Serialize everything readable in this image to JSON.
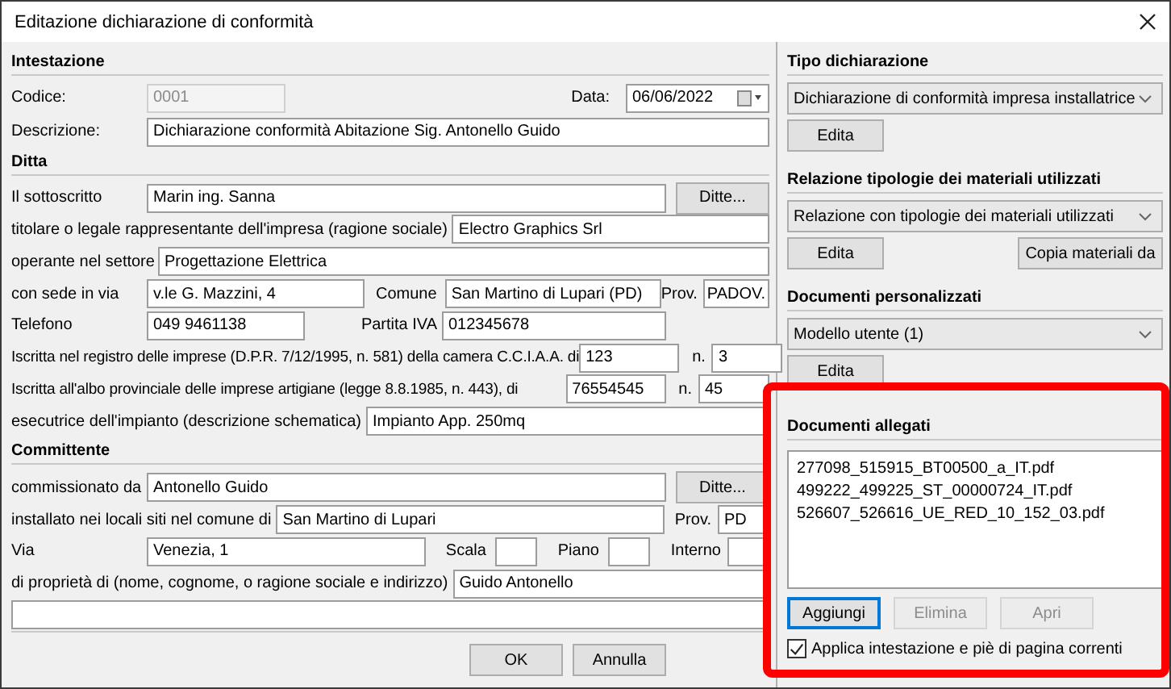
{
  "window": {
    "title": "Editazione dichiarazione di conformità"
  },
  "intestazione": {
    "title": "Intestazione",
    "codice": {
      "label": "Codice:",
      "value": "0001",
      "disabled": true
    },
    "data": {
      "label": "Data:",
      "value": "06/06/2022"
    },
    "descrizione": {
      "label": "Descrizione:",
      "value": "Dichiarazione conformità Abitazione Sig. Antonello Guido"
    }
  },
  "ditta": {
    "title": "Ditta",
    "sottoscritto": {
      "label": "Il sottoscritto",
      "value": "Marin ing. Sanna",
      "button": "Ditte..."
    },
    "titolare": {
      "label": "titolare o legale rappresentante dell'impresa (ragione sociale)",
      "value": "Electro Graphics Srl"
    },
    "settore": {
      "label": "operante nel settore",
      "value": "Progettazione Elettrica"
    },
    "sede": {
      "label": "con sede in via",
      "value": "v.le G. Mazzini, 4",
      "comune_label": "Comune",
      "comune": "San Martino di Lupari (PD)",
      "prov_label": "Prov.",
      "prov": "PADOV."
    },
    "telefono": {
      "label": "Telefono",
      "value": "049 9461138",
      "piva_label": "Partita IVA",
      "piva": "012345678"
    },
    "registro": {
      "label": "Iscritta nel registro delle imprese (D.P.R. 7/12/1995, n. 581) della camera C.C.I.A.A. di",
      "value": "123",
      "n_label": "n.",
      "n": "3"
    },
    "albo": {
      "label": "Iscritta all'albo provinciale delle imprese artigiane (legge 8.8.1985, n. 443), di",
      "value": "76554545",
      "n_label": "n.",
      "n": "45"
    },
    "esecutrice": {
      "label": "esecutrice dell'impianto (descrizione schematica)",
      "value": "Impianto App. 250mq"
    }
  },
  "committente": {
    "title": "Committente",
    "commissionato": {
      "label": "commissionato da",
      "value": "Antonello Guido",
      "button": "Ditte..."
    },
    "installato": {
      "label": "installato nei locali siti nel comune di",
      "value": "San Martino di Lupari",
      "prov_label": "Prov.",
      "prov": "PD"
    },
    "via": {
      "label": "Via",
      "value": "Venezia, 1",
      "scala_label": "Scala",
      "piano_label": "Piano",
      "interno_label": "Interno"
    },
    "proprieta": {
      "label": "di proprietà di (nome, cognome, o ragione sociale e indirizzo)",
      "value": "Guido Antonello"
    }
  },
  "buttons": [
    {
      "label": "OK"
    },
    {
      "label": "Annulla"
    }
  ],
  "tipo": {
    "title": "Tipo dichiarazione",
    "select": "Dichiarazione di conformità impresa installatrice",
    "button": "Edita"
  },
  "relazione": {
    "title": "Relazione tipologie dei materiali utilizzati",
    "select": "Relazione con tipologie dei materiali utilizzati",
    "buttons": [
      "Edita",
      "Copia materiali da"
    ]
  },
  "personalizzati": {
    "title": "Documenti personalizzati",
    "select": "Modello utente (1)",
    "button": "Edita"
  },
  "allegati": {
    "title": "Documenti allegati",
    "files": [
      "277098_515915_BT00500_a_IT.pdf",
      "499222_499225_ST_00000724_IT.pdf",
      "526607_526616_UE_RED_10_152_03.pdf"
    ],
    "buttons": [
      {
        "label": "Aggiungi",
        "disabled": false
      },
      {
        "label": "Elimina",
        "disabled": true
      },
      {
        "label": "Apri",
        "disabled": true
      }
    ],
    "apply": {
      "label": "Applica intestazione e piè di pagina correnti",
      "checked": true
    }
  }
}
